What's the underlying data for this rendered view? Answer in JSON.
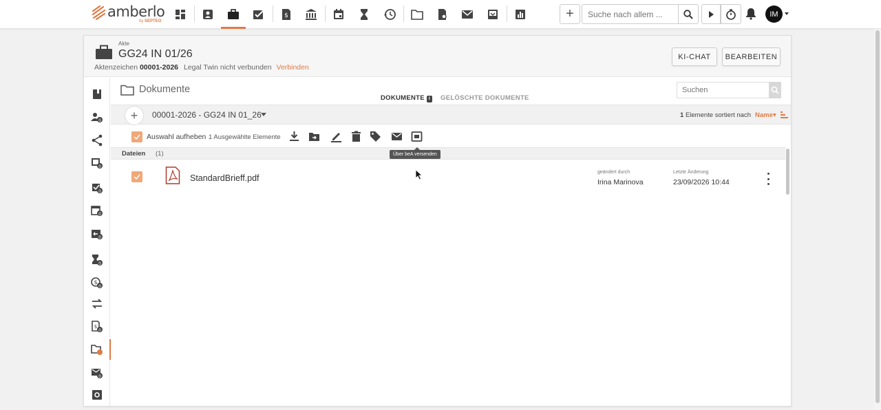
{
  "brand": {
    "name": "amberlo",
    "sub_prefix": "by",
    "sub_brand": "SEPTEO",
    "accent": "#e07a45"
  },
  "topnav": {
    "icons": [
      "dashboard-icon",
      "contacts-icon",
      "cases-icon",
      "tasks-icon",
      "billing-icon",
      "bank-icon",
      "calendar-icon",
      "hourglass-icon",
      "time-history-icon",
      "folder-icon",
      "document-search-icon",
      "mail-icon",
      "inbox-icon",
      "reports-icon"
    ],
    "active": "cases-icon",
    "search_placeholder": "Suche nach allem ...",
    "user_initials": "IM"
  },
  "case": {
    "type_label": "Akte",
    "title": "GG24 IN 01/26",
    "reference_label": "Aktenzeichen",
    "reference": "00001-2026",
    "twin_status": "Legal Twin nicht verbunden",
    "connect_link": "Verbinden",
    "btn_ai_chat": "KI-CHAT",
    "btn_edit": "BEARBEITEN"
  },
  "sidebar": {
    "icons": [
      "notebook-icon",
      "participants-icon",
      "share-icon",
      "documents-count-icon",
      "tasks-count-icon",
      "calendar-count-icon",
      "deadlines-count-icon",
      "hourglass-count-icon",
      "billing-time-count-icon",
      "transfer-icon",
      "invoice-count-icon",
      "folder-active-icon",
      "mail-count-icon",
      "settings-box-icon"
    ],
    "active": "folder-active-icon"
  },
  "documents": {
    "title": "Dokumente",
    "tab_documents": "DOKUMENTE",
    "tab_deleted": "GELÖSCHTE DOKUMENTE",
    "search_placeholder": "Suchen",
    "path": "00001-2026 - GG24 IN 01_26",
    "sort_count": "1",
    "sort_text": "Elemente sortiert nach",
    "sort_field": "Name",
    "deselect_label": "Auswahl aufheben",
    "selected_count": "1 Ausgewählte Elemente",
    "tooltip": "Über beA versenden",
    "files_label": "Dateien",
    "files_count": "(1)",
    "files": [
      {
        "name": "StandardBrieff.pdf",
        "changed_by_label": "geändert durch",
        "changed_by": "Irina Marinova",
        "last_change_label": "Letzte Änderung",
        "last_change": "23/09/2026 10:44",
        "selected": true
      }
    ]
  }
}
